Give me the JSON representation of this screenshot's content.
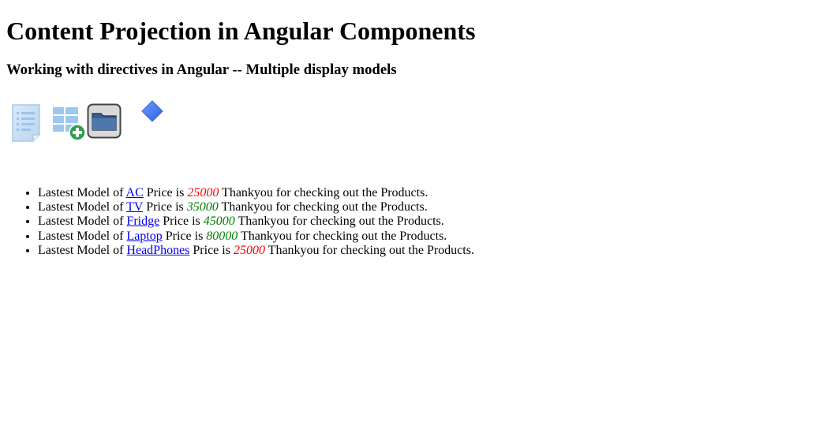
{
  "page": {
    "title": "Content Projection in Angular Components",
    "subtitle": "Working with directives in Angular -- Multiple display models"
  },
  "icons": [
    {
      "name": "list-document-icon"
    },
    {
      "name": "grid-add-icon"
    },
    {
      "name": "folder-icon"
    },
    {
      "name": "blue-diamond-icon"
    }
  ],
  "colors": {
    "price_red": "#ff0000",
    "price_green": "#008000",
    "link_blue": "#0000ee"
  },
  "products": [
    {
      "prefix": "Lastest Model of",
      "name": "AC",
      "price_label": "Price is",
      "price": "25000",
      "price_color": "#ff0000",
      "suffix": "Thankyou for checking out the Products."
    },
    {
      "prefix": "Lastest Model of",
      "name": "TV",
      "price_label": "Price is",
      "price": "35000",
      "price_color": "#008000",
      "suffix": "Thankyou for checking out the Products."
    },
    {
      "prefix": "Lastest Model of",
      "name": "Fridge",
      "price_label": "Price is",
      "price": "45000",
      "price_color": "#008000",
      "suffix": "Thankyou for checking out the Products."
    },
    {
      "prefix": "Lastest Model of",
      "name": "Laptop",
      "price_label": "Price is",
      "price": "80000",
      "price_color": "#008000",
      "suffix": "Thankyou for checking out the Products."
    },
    {
      "prefix": "Lastest Model of",
      "name": "HeadPhones",
      "price_label": "Price is",
      "price": "25000",
      "price_color": "#ff0000",
      "suffix": "Thankyou for checking out the Products."
    }
  ]
}
